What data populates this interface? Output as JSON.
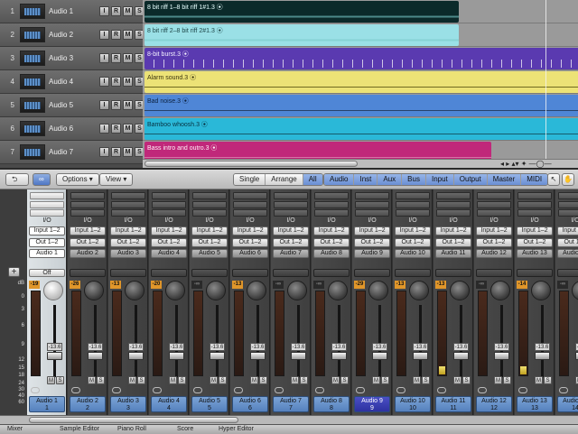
{
  "tracks": [
    {
      "num": "1",
      "name": "Audio 1"
    },
    {
      "num": "2",
      "name": "Audio 2"
    },
    {
      "num": "3",
      "name": "Audio 3"
    },
    {
      "num": "4",
      "name": "Audio 4"
    },
    {
      "num": "5",
      "name": "Audio 5"
    },
    {
      "num": "6",
      "name": "Audio 6"
    },
    {
      "num": "7",
      "name": "Audio 7"
    }
  ],
  "track_buttons": [
    "I",
    "R",
    "M",
    "S"
  ],
  "regions": [
    {
      "name": "8 bit riff 1–8 bit riff 1#1.3 ⦿",
      "color": "#0b2a2a",
      "text": "#e8ffff"
    },
    {
      "name": "8 bit riff 2–8 bit riff 2#1.3 ⦿",
      "color": "#9ae0e6",
      "text": "#20484a"
    },
    {
      "name": "8-bit burst.3 ⦿",
      "color": "#5a3ab0",
      "text": "#f4f0ff"
    },
    {
      "name": "Alarm sound.3 ⦿",
      "color": "#ece276",
      "text": "#3a3410"
    },
    {
      "name": "Bad noise.3 ⦿",
      "color": "#4f86d6",
      "text": "#0d2240"
    },
    {
      "name": "Bamboo whoosh.3 ⦿",
      "color": "#2ab8d8",
      "text": "#083040"
    },
    {
      "name": "Bass intro and outro.3 ⦿",
      "color": "#c0287a",
      "text": "#fff0f8"
    }
  ],
  "toolbar": {
    "options": "Options ▾",
    "view": "View ▾",
    "modes": [
      "Single",
      "Arrange",
      "All"
    ],
    "filters": [
      "Audio",
      "Inst",
      "Aux",
      "Bus",
      "Input",
      "Output",
      "Master",
      "MIDI"
    ]
  },
  "db_scale": [
    "dB",
    "0",
    "3",
    "6",
    "9",
    "12",
    "15",
    "18",
    "24",
    "30",
    "40",
    "60"
  ],
  "strips": [
    {
      "io": "I/O",
      "input": "Input 1–2",
      "output": "Out 1–2",
      "group": "Audio 1",
      "auto": "Off",
      "peak": "-19",
      "vol": "-13.6",
      "name1": "Audio 1",
      "name2": "1"
    },
    {
      "io": "I/O",
      "input": "Input 1–2",
      "output": "Out 1–2",
      "group": "Audio 2",
      "auto": "",
      "peak": "-26",
      "vol": "-13.6",
      "name1": "Audio 2",
      "name2": "2"
    },
    {
      "io": "I/O",
      "input": "Input 1–2",
      "output": "Out 1–2",
      "group": "Audio 3",
      "auto": "",
      "peak": "-13",
      "vol": "-13.6",
      "name1": "Audio 3",
      "name2": "3"
    },
    {
      "io": "I/O",
      "input": "Input 1–2",
      "output": "Out 1–2",
      "group": "Audio 4",
      "auto": "",
      "peak": "-20",
      "vol": "-13.6",
      "name1": "Audio 4",
      "name2": "4"
    },
    {
      "io": "I/O",
      "input": "Input 1–2",
      "output": "Out 1–2",
      "group": "Audio 5",
      "auto": "",
      "peak": "-∞",
      "vol": "-13.6",
      "name1": "Audio 5",
      "name2": "5"
    },
    {
      "io": "I/O",
      "input": "Input 1–2",
      "output": "Out 1–2",
      "group": "Audio 6",
      "auto": "",
      "peak": "-13",
      "vol": "-13.6",
      "name1": "Audio 6",
      "name2": "6"
    },
    {
      "io": "I/O",
      "input": "Input 1–2",
      "output": "Out 1–2",
      "group": "Audio 7",
      "auto": "",
      "peak": "-∞",
      "vol": "-13.6",
      "name1": "Audio 7",
      "name2": "7"
    },
    {
      "io": "I/O",
      "input": "Input 1–2",
      "output": "Out 1–2",
      "group": "Audio 8",
      "auto": "",
      "peak": "-∞",
      "vol": "-13.6",
      "name1": "Audio 8",
      "name2": "8"
    },
    {
      "io": "I/O",
      "input": "Input 1–2",
      "output": "Out 1–2",
      "group": "Audio 9",
      "auto": "",
      "peak": "-29",
      "vol": "-13.6",
      "name1": "Audio 9",
      "name2": "9"
    },
    {
      "io": "I/O",
      "input": "Input 1–2",
      "output": "Out 1–2",
      "group": "Audio 10",
      "auto": "",
      "peak": "-13",
      "vol": "-13.6",
      "name1": "Audio 10",
      "name2": "10"
    },
    {
      "io": "I/O",
      "input": "Input 1–2",
      "output": "Out 1–2",
      "group": "Audio 11",
      "auto": "",
      "peak": "-13",
      "vol": "-13.6",
      "name1": "Audio 11",
      "name2": "11"
    },
    {
      "io": "I/O",
      "input": "Input 1–2",
      "output": "Out 1–2",
      "group": "Audio 12",
      "auto": "",
      "peak": "-∞",
      "vol": "-13.6",
      "name1": "Audio 12",
      "name2": "12"
    },
    {
      "io": "I/O",
      "input": "Input 1–2",
      "output": "Out 1–2",
      "group": "Audio 13",
      "auto": "",
      "peak": "-14",
      "vol": "-13.6",
      "name1": "Audio 13",
      "name2": "13"
    },
    {
      "io": "I/O",
      "input": "Input 1–2",
      "output": "Out 1–2",
      "group": "Audio 14",
      "auto": "",
      "peak": "-∞",
      "vol": "-13.6",
      "name1": "Audio 14",
      "name2": "14"
    }
  ],
  "bottom_tabs": [
    "Mixer",
    "Sample Editor",
    "Piano Roll",
    "Score",
    "Hyper Editor"
  ]
}
